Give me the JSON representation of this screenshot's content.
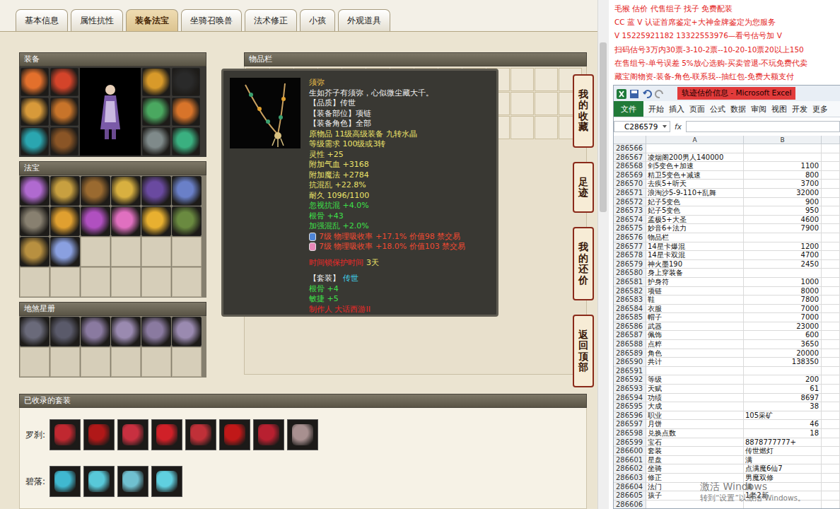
{
  "tabs": [
    {
      "label": "基本信息",
      "selected": false
    },
    {
      "label": "属性抗性",
      "selected": false
    },
    {
      "label": "装备法宝",
      "selected": true
    },
    {
      "label": "坐骑召唤兽",
      "selected": false
    },
    {
      "label": "法术修正",
      "selected": false
    },
    {
      "label": "小孩",
      "selected": false
    },
    {
      "label": "外观道具",
      "selected": false
    }
  ],
  "panels": {
    "equipment": "装备",
    "treasures": "法宝",
    "star_book": "地煞星册",
    "inventory": "物品栏"
  },
  "tooltip": {
    "lines": [
      {
        "kind": "text",
        "segments": [
          {
            "text": "须弥",
            "color": "#f0c24a"
          }
        ]
      },
      {
        "kind": "text",
        "segments": [
          {
            "text": "生如芥子有须弥，心似微尘藏大千。",
            "color": "#f2f2f2"
          }
        ]
      },
      {
        "kind": "text",
        "segments": [
          {
            "text": "【品质】传世",
            "color": "#f2f2f2"
          }
        ]
      },
      {
        "kind": "text",
        "segments": [
          {
            "text": "【装备部位】项链",
            "color": "#f2f2f2"
          }
        ]
      },
      {
        "kind": "text",
        "segments": [
          {
            "text": "【装备角色】全部",
            "color": "#f2f2f2"
          }
        ]
      },
      {
        "kind": "text",
        "segments": [
          {
            "text": "原物品 11级高级装备 九转水晶",
            "color": "#ece36a"
          }
        ]
      },
      {
        "kind": "text",
        "segments": [
          {
            "text": "等级需求 100级或3转",
            "color": "#ece36a"
          }
        ]
      },
      {
        "kind": "text",
        "segments": [
          {
            "text": "灵性 +25",
            "color": "#ece36a"
          }
        ]
      },
      {
        "kind": "text",
        "segments": [
          {
            "text": "附加气血 +3168",
            "color": "#ece36a"
          }
        ]
      },
      {
        "kind": "text",
        "segments": [
          {
            "text": "附加魔法 +2784",
            "color": "#ece36a"
          }
        ]
      },
      {
        "kind": "text",
        "segments": [
          {
            "text": "抗混乱 +22.8%",
            "color": "#ece36a"
          }
        ]
      },
      {
        "kind": "text",
        "segments": [
          {
            "text": "耐久 1096/1100",
            "color": "#ece36a"
          }
        ]
      },
      {
        "kind": "text",
        "segments": [
          {
            "text": "忽视抗混 +4.0%",
            "color": "#3ee04a"
          }
        ]
      },
      {
        "kind": "text",
        "segments": [
          {
            "text": "根骨 +43",
            "color": "#3ee04a"
          }
        ]
      },
      {
        "kind": "text",
        "segments": [
          {
            "text": "加强混乱 +2.0%",
            "color": "#3ee04a"
          }
        ]
      },
      {
        "kind": "gem",
        "gem_color": "#4f86d8",
        "segments": [
          {
            "text": "7级 物理吸收率 +17.1% 价值98 禁交易",
            "color": "#f04a32"
          }
        ]
      },
      {
        "kind": "gem",
        "gem_color": "#e888b8",
        "segments": [
          {
            "text": "7级 物理吸收率 +18.0% 价值103 禁交易",
            "color": "#f04a32"
          }
        ]
      },
      {
        "kind": "gap"
      },
      {
        "kind": "text",
        "segments": [
          {
            "text": "时间锁保护时间",
            "color": "#f02828"
          },
          {
            "text": "3天",
            "color": "#ece36a"
          }
        ]
      },
      {
        "kind": "gap"
      },
      {
        "kind": "text",
        "segments": [
          {
            "text": "【套装】",
            "color": "#f2f2f2"
          },
          {
            "text": "传世",
            "color": "#40d4f0"
          }
        ]
      },
      {
        "kind": "text",
        "segments": [
          {
            "text": "根骨 +4",
            "color": "#3ee04a"
          }
        ]
      },
      {
        "kind": "text",
        "segments": [
          {
            "text": "敏捷 +5",
            "color": "#3ee04a"
          }
        ]
      },
      {
        "kind": "text",
        "segments": [
          {
            "text": "制作人 大话西游II",
            "color": "#f02828"
          }
        ]
      }
    ]
  },
  "side_buttons": [
    "我的收藏",
    "足迹",
    "我的还价",
    "返回顶部"
  ],
  "sets": {
    "title": "已收录的套装",
    "groups": [
      {
        "label": "罗刹:"
      },
      {
        "label": "碧落:"
      }
    ]
  },
  "ad": {
    "lines": [
      "毛猴 估价 代售组子 找子 免费配装",
      "CC 蓝 V 认证首席鉴定+大神金牌鉴定为您服务",
      "V 15225921182  13322553976—看号估号加 V",
      "扫码估号3万内30票-3-10-2票--10-20-10票20以上150",
      "在售组号-单号误差 5%放心选购-买卖管退-不玩免费代卖",
      "藏宝阁物资-装备-角色-联系我--抽红包-免费大额支付"
    ]
  },
  "excel": {
    "title": "轨迹估价信息 - Microsoft Excel",
    "file_button": "文件",
    "ribbon_tabs": [
      "开始",
      "插入",
      "页面",
      "公式",
      "数据",
      "审阅",
      "视图",
      "开发",
      "更多"
    ],
    "name_box": "C286579",
    "fx": "fx",
    "columns": [
      "A",
      "B"
    ],
    "rows": [
      {
        "num": "286566",
        "a": "",
        "b": "",
        "kind": "text"
      },
      {
        "num": "286567",
        "a": "凌烟阁200男人140000",
        "b": "",
        "kind": "text"
      },
      {
        "num": "286568",
        "a": "剑5变色+加速",
        "b": "1100",
        "kind": "num"
      },
      {
        "num": "286569",
        "a": "精卫5变色+减速",
        "b": "800",
        "kind": "num"
      },
      {
        "num": "286570",
        "a": "去疾5+听天",
        "b": "3700",
        "kind": "num"
      },
      {
        "num": "286571",
        "a": "浪淘沙5-9-110+乱舞",
        "b": "32000",
        "kind": "num"
      },
      {
        "num": "286572",
        "a": "妃子5变色",
        "b": "900",
        "kind": "num"
      },
      {
        "num": "286573",
        "a": "妃子5变色",
        "b": "950",
        "kind": "num"
      },
      {
        "num": "286574",
        "a": "孟极5+大圣",
        "b": "4600",
        "kind": "num"
      },
      {
        "num": "286575",
        "a": "妙音6+法力",
        "b": "7900",
        "kind": "num"
      },
      {
        "num": "286576",
        "a": "物品栏",
        "b": "",
        "kind": "text"
      },
      {
        "num": "286577",
        "a": "14星卡爆混",
        "b": "1200",
        "kind": "num"
      },
      {
        "num": "286578",
        "a": "14星卡双混",
        "b": "4700",
        "kind": "num"
      },
      {
        "num": "286579",
        "a": "神火墨190",
        "b": "2450",
        "kind": "num"
      },
      {
        "num": "286580",
        "a": "身上穿装备",
        "b": "",
        "kind": "text"
      },
      {
        "num": "286581",
        "a": "护身符",
        "b": "1000",
        "kind": "num"
      },
      {
        "num": "286582",
        "a": "项链",
        "b": "8000",
        "kind": "num"
      },
      {
        "num": "286583",
        "a": "鞋",
        "b": "7800",
        "kind": "num"
      },
      {
        "num": "286584",
        "a": "衣服",
        "b": "7000",
        "kind": "num"
      },
      {
        "num": "286585",
        "a": "帽子",
        "b": "7000",
        "kind": "num"
      },
      {
        "num": "286586",
        "a": "武器",
        "b": "23000",
        "kind": "num"
      },
      {
        "num": "286587",
        "a": "佩饰",
        "b": "600",
        "kind": "num"
      },
      {
        "num": "286588",
        "a": "点粹",
        "b": "3650",
        "kind": "num"
      },
      {
        "num": "286589",
        "a": "角色",
        "b": "20000",
        "kind": "num"
      },
      {
        "num": "286590",
        "a": "共计",
        "b": "138350",
        "kind": "num"
      },
      {
        "num": "286591",
        "a": "",
        "b": "",
        "kind": "text"
      },
      {
        "num": "286592",
        "a": "等级",
        "b": "200",
        "kind": "num"
      },
      {
        "num": "286593",
        "a": "天赋",
        "b": "61",
        "kind": "num"
      },
      {
        "num": "286594",
        "a": "功绩",
        "b": "8697",
        "kind": "num"
      },
      {
        "num": "286595",
        "a": "大成",
        "b": "38",
        "kind": "num"
      },
      {
        "num": "286596",
        "a": "职业",
        "b": "105采矿",
        "kind": "text"
      },
      {
        "num": "286597",
        "a": "月饼",
        "b": "46",
        "kind": "num"
      },
      {
        "num": "286598",
        "a": "兑换点数",
        "b": "18",
        "kind": "num"
      },
      {
        "num": "286599",
        "a": "宝石",
        "b": "8878777777+",
        "kind": "text"
      },
      {
        "num": "286600",
        "a": "套装",
        "b": "传世燃灯",
        "kind": "text"
      },
      {
        "num": "286601",
        "a": "星盘",
        "b": "满",
        "kind": "text"
      },
      {
        "num": "286602",
        "a": "坐骑",
        "b": "点满魔6仙7",
        "kind": "text"
      },
      {
        "num": "286603",
        "a": "修正",
        "b": "男魔双修",
        "kind": "text"
      },
      {
        "num": "286604",
        "a": "法门",
        "b": "满",
        "kind": "text"
      },
      {
        "num": "286605",
        "a": "孩子",
        "b": "1老2新",
        "kind": "text"
      },
      {
        "num": "286606",
        "a": "",
        "b": "",
        "kind": "text"
      }
    ]
  },
  "watermark": [
    "激活 Windows",
    "转到“设置”以激活 Windows。"
  ]
}
